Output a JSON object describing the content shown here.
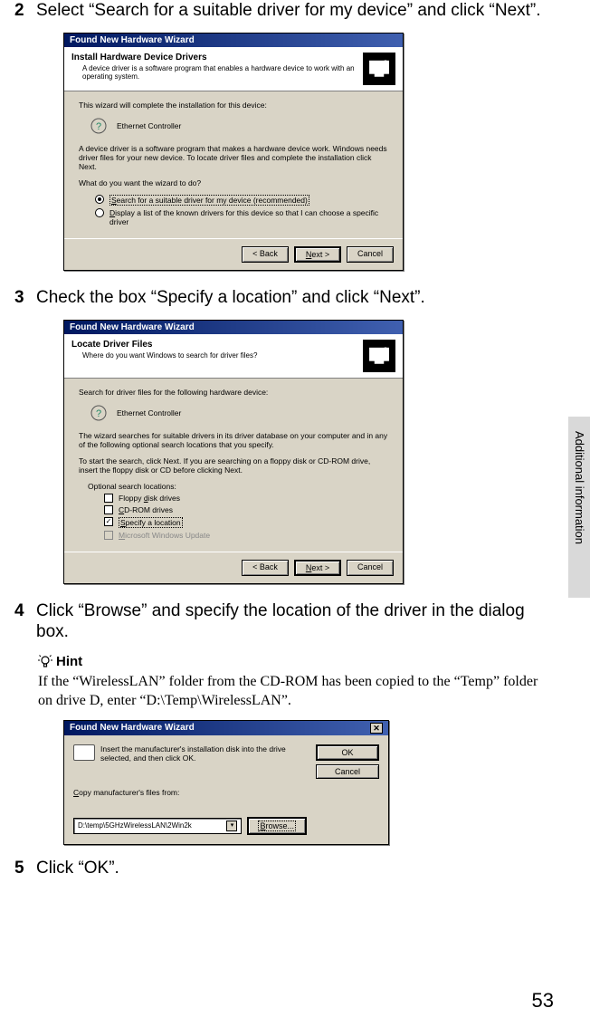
{
  "sidebar_label": "Additional information",
  "page_number": "53",
  "steps": {
    "s2": {
      "num": "2",
      "text": "Select “Search for a suitable driver for my device” and click “Next”."
    },
    "s3": {
      "num": "3",
      "text": "Check the box “Specify a location” and click “Next”."
    },
    "s4": {
      "num": "4",
      "text": "Click “Browse” and specify the location of the driver in the dialog box."
    },
    "s5": {
      "num": "5",
      "text": "Click “OK”."
    }
  },
  "hint": {
    "label": "Hint",
    "body": "If the “WirelessLAN” folder from the CD-ROM has been copied to the “Temp” folder on drive D, enter “D:\\Temp\\WirelessLAN”."
  },
  "wizard1": {
    "title": "Found New Hardware Wizard",
    "header_title": "Install Hardware Device Drivers",
    "header_sub": "A device driver is a software program that enables a hardware device to work with an operating system.",
    "line1": "This wizard will complete the installation for this device:",
    "device": "Ethernet Controller",
    "para2": "A device driver is a software program that makes a hardware device work. Windows needs driver files for your new device. To locate driver files and complete the installation click Next.",
    "question": "What do you want the wizard to do?",
    "opt1": "Search for a suitable driver for my device (recommended)",
    "opt2": "Display a list of the known drivers for this device so that I can choose a specific driver",
    "btn_back": "< Back",
    "btn_next": "Next >",
    "btn_cancel": "Cancel"
  },
  "wizard2": {
    "title": "Found New Hardware Wizard",
    "header_title": "Locate Driver Files",
    "header_sub": "Where do you want Windows to search for driver files?",
    "line1": "Search for driver files for the following hardware device:",
    "device": "Ethernet Controller",
    "para2": "The wizard searches for suitable drivers in its driver database on your computer and in any of the following optional search locations that you specify.",
    "para3": "To start the search, click Next. If you are searching on a floppy disk or CD-ROM drive, insert the floppy disk or CD before clicking Next.",
    "opt_label": "Optional search locations:",
    "opt_floppy": "Floppy disk drives",
    "opt_cd": "CD-ROM drives",
    "opt_spec": "Specify a location",
    "opt_wu": "Microsoft Windows Update",
    "btn_back": "< Back",
    "btn_next": "Next >",
    "btn_cancel": "Cancel"
  },
  "wizard3": {
    "title": "Found New Hardware Wizard",
    "msg": "Insert the manufacturer's installation disk into the drive selected, and then click OK.",
    "copy_label": "Copy manufacturer's files from:",
    "path": "D:\\temp\\5GHzWirelessLAN\\2Win2k",
    "btn_ok": "OK",
    "btn_cancel": "Cancel",
    "btn_browse": "Browse..."
  }
}
